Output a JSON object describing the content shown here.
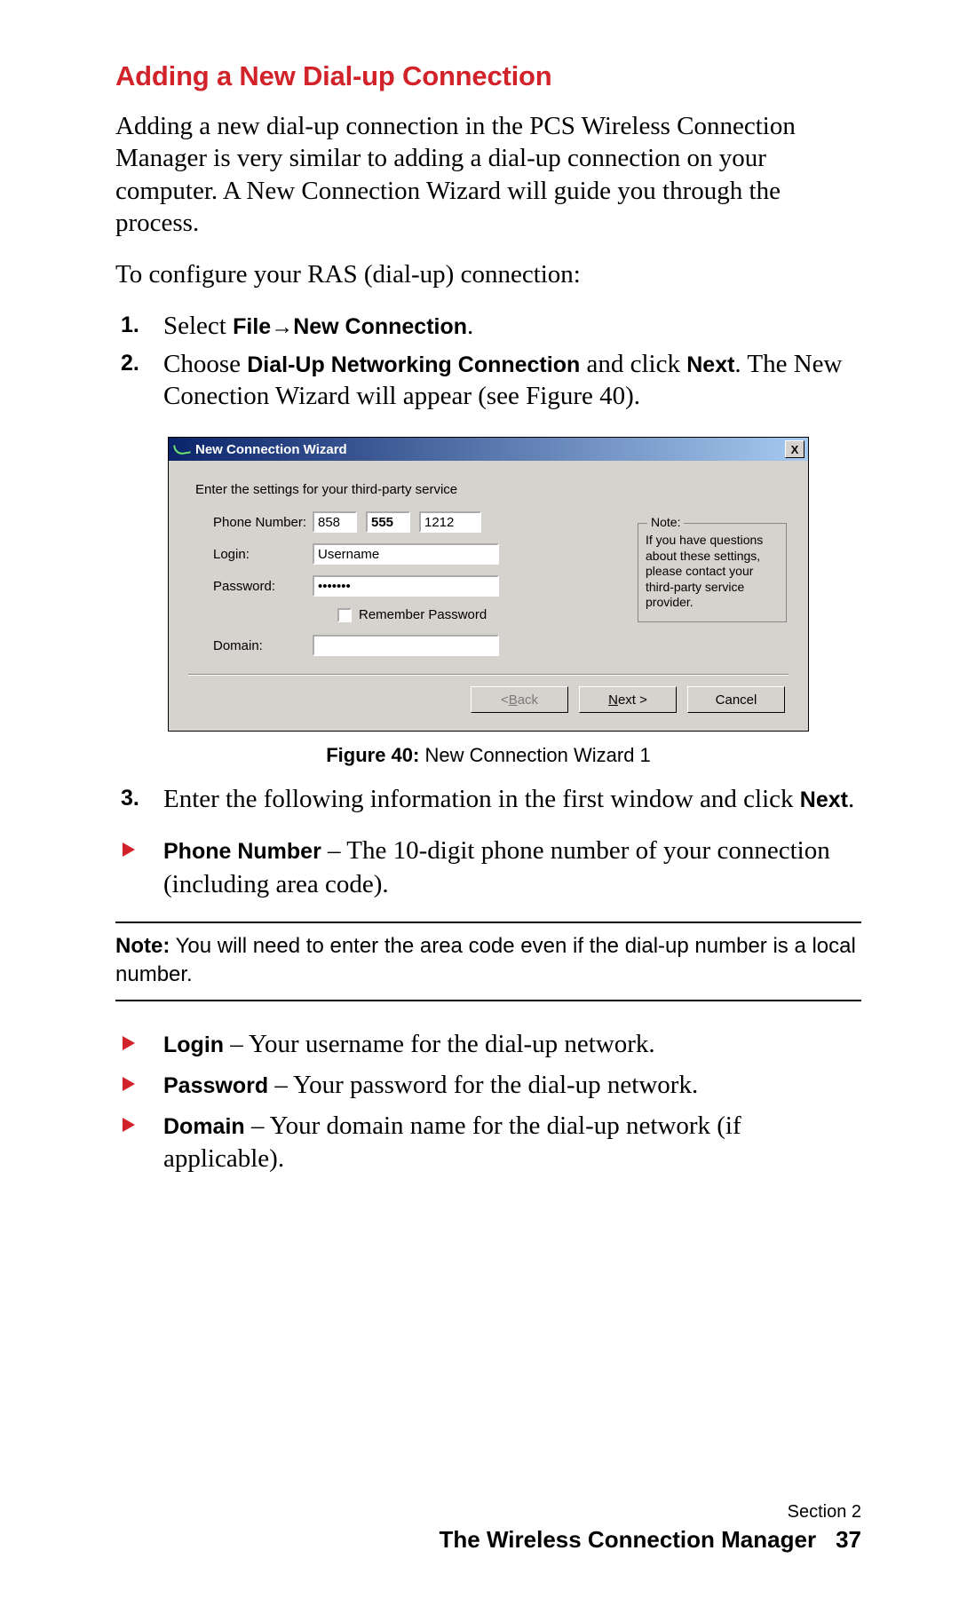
{
  "heading": "Adding a New Dial-up Connection",
  "intro": "Adding a new dial-up connection in the PCS Wireless Connection Manager is very similar to adding a dial-up connection on your computer. A New Connection Wizard will guide you through the process.",
  "lead": "To configure your RAS (dial-up) connection:",
  "steps": {
    "n1": "1.",
    "s1_pre": "Select ",
    "s1_b1": "File",
    "s1_arrow": "→",
    "s1_b2": "New Connection",
    "s1_post": ".",
    "n2": "2.",
    "s2_pre": "Choose ",
    "s2_b": "Dial-Up Networking Connection",
    "s2_mid": " and click ",
    "s2_b2": "Next",
    "s2_post": ". The New Conection Wizard will appear (see Figure 40).",
    "n3": "3.",
    "s3_pre": "Enter the following information in the first window and click ",
    "s3_b": "Next",
    "s3_post": "."
  },
  "wizard": {
    "title": "New Connection Wizard",
    "close": "X",
    "prompt": "Enter the settings for your third-party service",
    "labels": {
      "phone": "Phone Number:",
      "login": "Login:",
      "password": "Password:",
      "domain": "Domain:",
      "remember": "Remember Password"
    },
    "values": {
      "area": "858",
      "prefix": "555",
      "line": "1212",
      "login": "Username",
      "password": "•••••••",
      "domain": ""
    },
    "note": {
      "title": "Note:",
      "text": "If you have questions about these settings, please contact your third-party service provider."
    },
    "buttons": {
      "back_lt": "< ",
      "back_u": "B",
      "back_rest": "ack",
      "next_u": "N",
      "next_rest": "ext >",
      "cancel": "Cancel"
    }
  },
  "caption": {
    "bold": "Figure 40:",
    "rest": " New Connection Wizard 1"
  },
  "bullets1": {
    "phone_b": "Phone Number",
    "phone_t": " – The 10-digit phone number of your connection (including area code)."
  },
  "note": {
    "b": "Note:",
    "t": " You will need to enter the area code even if the dial-up number is a local number."
  },
  "bullets2": {
    "login_b": "Login",
    "login_t": " – Your username for the dial-up network.",
    "pw_b": "Password",
    "pw_t": " – Your password for the dial-up network.",
    "dom_b": "Domain",
    "dom_t": " – Your domain name for the dial-up network (if applicable)."
  },
  "footer": {
    "section": "Section 2",
    "title": "The Wireless Connection Manager",
    "page": "37"
  }
}
